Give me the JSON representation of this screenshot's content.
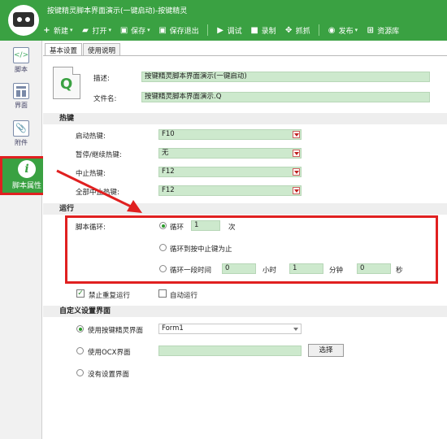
{
  "window": {
    "title": "按键精灵脚本界面演示(一键启动)-按键精灵"
  },
  "toolbar": [
    {
      "key": "new",
      "label": "新建",
      "icon": "plus-icon",
      "caret": true
    },
    {
      "key": "open",
      "label": "打开",
      "icon": "folder-icon",
      "caret": true
    },
    {
      "key": "save",
      "label": "保存",
      "icon": "save-icon",
      "caret": true
    },
    {
      "key": "save-exit",
      "label": "保存退出",
      "icon": "save-exit-icon",
      "caret": false
    },
    {
      "key": "debug",
      "label": "调试",
      "icon": "play-icon",
      "caret": false
    },
    {
      "key": "record",
      "label": "录制",
      "icon": "camera-icon",
      "caret": false
    },
    {
      "key": "grab",
      "label": "抓抓",
      "icon": "grab-icon",
      "caret": false
    },
    {
      "key": "publish",
      "label": "发布",
      "icon": "globe-icon",
      "caret": true
    },
    {
      "key": "resources",
      "label": "资源库",
      "icon": "plus-box-icon",
      "caret": false
    }
  ],
  "sidebar": {
    "items": [
      {
        "label": "脚本",
        "icon": "script-icon"
      },
      {
        "label": "界面",
        "icon": "layout-icon"
      },
      {
        "label": "附件",
        "icon": "attachment-icon"
      },
      {
        "label": "脚本属性",
        "icon": "info-icon",
        "glyph": "i",
        "active": true
      }
    ]
  },
  "tabs": [
    {
      "label": "基本设置",
      "active": true
    },
    {
      "label": "使用说明",
      "active": false
    }
  ],
  "basic": {
    "file_icon_letter": "Q",
    "desc_label": "描述:",
    "desc_value": "按键精灵脚本界面演示(一键启动)",
    "filename_label": "文件名:",
    "filename_value": "按键精灵脚本界面演示.Q"
  },
  "hotkeys": {
    "title": "热键",
    "rows": [
      {
        "label": "启动热键:",
        "value": "F10"
      },
      {
        "label": "暂停/继续热键:",
        "value": "无"
      },
      {
        "label": "中止热键:",
        "value": "F12"
      },
      {
        "label": "全部中止热键:",
        "value": "F12"
      }
    ]
  },
  "run": {
    "title": "运行",
    "loop_label": "脚本循环:",
    "loop_option": "循环",
    "loop_count": "1",
    "loop_unit": "次",
    "until_stop_option": "循环到按中止键为止",
    "duration_option": "循环一段时间",
    "hours": "0",
    "hours_unit": "小时",
    "minutes": "1",
    "minutes_unit": "分钟",
    "seconds": "0",
    "seconds_unit": "秒",
    "no_repeat_label": "禁止重复运行",
    "no_repeat_checked": true,
    "auto_run_label": "自动运行",
    "auto_run_checked": false
  },
  "custom_ui": {
    "title": "自定义设置界面",
    "opt_builtin": "使用按键精灵界面",
    "builtin_value": "Form1",
    "opt_ocx": "使用OCX界面",
    "select_button": "选择",
    "opt_none": "没有设置界面"
  },
  "colors": {
    "accent": "#3aa142",
    "highlight": "#e02020",
    "field": "#cde9cd"
  }
}
